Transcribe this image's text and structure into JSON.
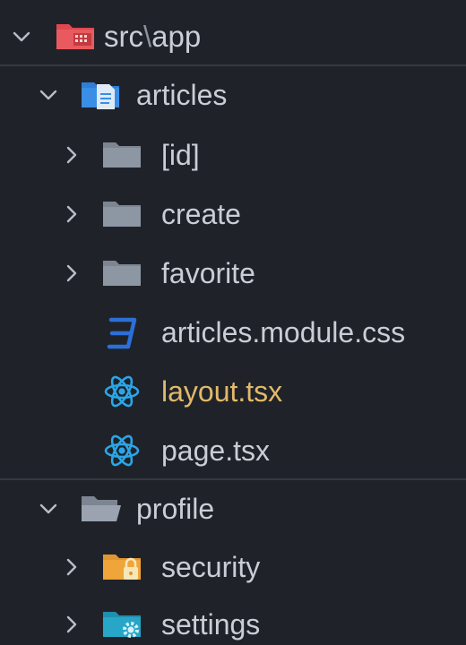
{
  "explorer": {
    "root": {
      "path_prefix": "src",
      "path_separator": "\\",
      "path_suffix": "app",
      "icon": "src-folder-icon",
      "expanded": true
    },
    "articles": {
      "label": "articles",
      "icon": "articles-folder-icon",
      "expanded": true,
      "children": [
        {
          "label": "[id]",
          "type": "folder",
          "icon": "folder-icon",
          "expanded": false
        },
        {
          "label": "create",
          "type": "folder",
          "icon": "folder-icon",
          "expanded": false
        },
        {
          "label": "favorite",
          "type": "folder",
          "icon": "folder-icon",
          "expanded": false
        },
        {
          "label": "articles.module.css",
          "type": "file",
          "icon": "css-file-icon"
        },
        {
          "label": "layout.tsx",
          "type": "file",
          "icon": "react-file-icon",
          "modified": true
        },
        {
          "label": "page.tsx",
          "type": "file",
          "icon": "react-file-icon"
        }
      ]
    },
    "profile": {
      "label": "profile",
      "icon": "open-folder-icon",
      "expanded": true,
      "children": [
        {
          "label": "security",
          "type": "folder",
          "icon": "security-folder-icon",
          "expanded": false
        },
        {
          "label": "settings",
          "type": "folder",
          "icon": "settings-folder-icon",
          "expanded": false
        }
      ]
    }
  },
  "colors": {
    "background": "#1f2329",
    "text": "#c9ced6",
    "modified_text": "#e2b96a",
    "folder_grey": "#8d96a3",
    "src_folder": "#e0484f",
    "articles_folder": "#3a8ee6",
    "css_icon": "#2d6fd8",
    "react_icon": "#2aa6e8",
    "security_folder": "#f0a53a",
    "settings_folder": "#27a6c8"
  }
}
